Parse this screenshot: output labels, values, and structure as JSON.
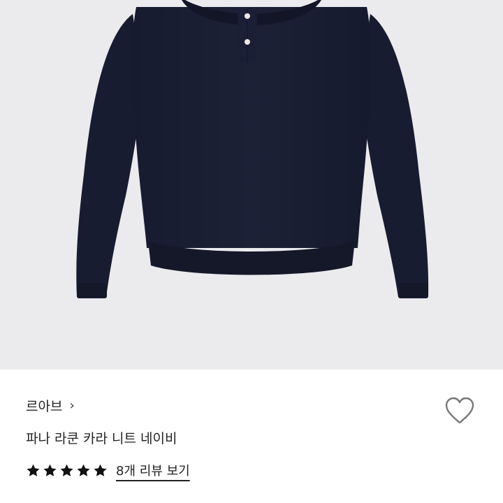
{
  "product": {
    "brand": "르아브",
    "name": "파나 라쿤 카라 니트 네이비",
    "rating_stars": 5,
    "review_link": "8개 리뷰 보기",
    "image_description": "navy knit collar sweater"
  },
  "colors": {
    "image_background": "#ebebee",
    "sweater": "#1a1e33",
    "text": "#222222",
    "heart_outline": "#777777",
    "star": "#111111"
  },
  "icons": {
    "brand_chevron": "chevron-right-icon",
    "wishlist": "heart-outline-icon",
    "star": "star-icon"
  }
}
